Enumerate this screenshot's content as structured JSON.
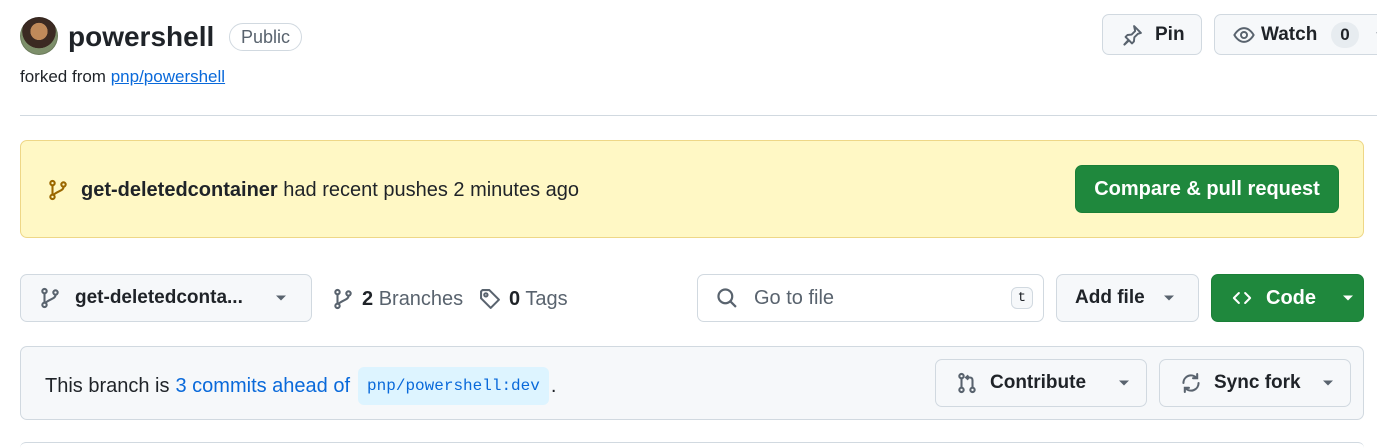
{
  "repo": {
    "name": "powershell",
    "visibility": "Public",
    "forked_prefix": "forked from",
    "forked_from": "pnp/powershell"
  },
  "actions": {
    "pin_label": "Pin",
    "watch_label": "Watch",
    "watch_count": "0"
  },
  "banner": {
    "branch": "get-deletedcontainer",
    "message": "had recent pushes 2 minutes ago",
    "button": "Compare & pull request"
  },
  "toolbar": {
    "current_branch": "get-deletedconta...",
    "branches_count": "2",
    "branches_label": "Branches",
    "tags_count": "0",
    "tags_label": "Tags",
    "search_placeholder": "Go to file",
    "search_shortcut": "t",
    "add_file": "Add file",
    "code": "Code"
  },
  "branch_status": {
    "prefix": "This branch is",
    "ahead_link": "3 commits ahead of",
    "upstream": "pnp/powershell:dev",
    "suffix": ".",
    "contribute": "Contribute",
    "sync_fork": "Sync fork"
  },
  "colors": {
    "accent": "#0969da",
    "primary_green": "#1f883d",
    "banner_bg": "#fff8c5",
    "banner_icon": "#9a6700"
  }
}
